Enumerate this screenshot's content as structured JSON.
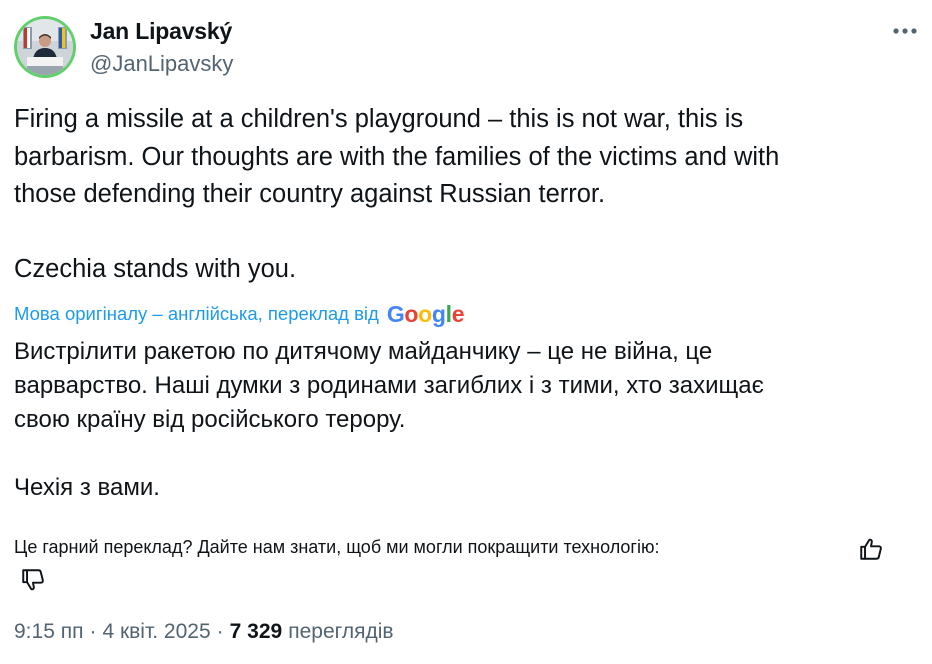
{
  "author": {
    "display_name": "Jan Lipavský",
    "handle": "@JanLipavsky"
  },
  "tweet": {
    "original_text": "Firing a missile at a children's playground – this is not war, this is\nbarbarism. Our thoughts are with the families of the victims and with\nthose defending their country against Russian terror.\n\nCzechia stands with you.",
    "translation_label": "Мова оригіналу – англійська, переклад від",
    "translation_provider": "Google",
    "translated_text": "Вистрілити ракетою по дитячому майданчику – це не війна, це\nварварство. Наші думки з родинами загиблих і з тими, хто захищає\nсвою країну від російського терору.\n\nЧехія з вами.",
    "feedback_prompt": "Це гарний переклад? Дайте нам знати, щоб ми могли покращити технологію:",
    "time": "9:15 пп",
    "date": "4 квіт. 2025",
    "separator": "·",
    "views_count": "7 329",
    "views_label": "переглядів"
  },
  "icons": {
    "more": "more-horizontal-icon",
    "thumbs_up": "thumbs-up-icon",
    "thumbs_down": "thumbs-down-icon"
  },
  "colors": {
    "text_primary": "#0f1419",
    "text_secondary": "#536471",
    "link": "#1d9bf0",
    "avatar_ring": "#5fd06a",
    "google_blue": "#4285f4",
    "google_red": "#ea4335",
    "google_yellow": "#fbbc05",
    "google_green": "#34a853"
  }
}
